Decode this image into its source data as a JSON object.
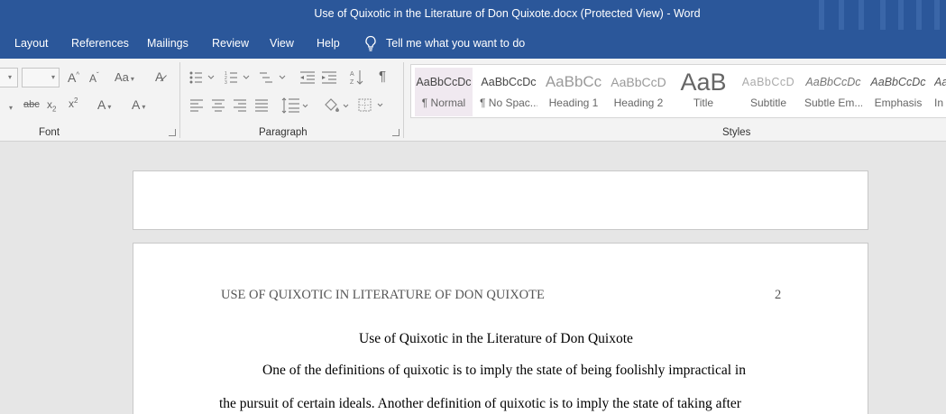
{
  "window": {
    "title": "Use of Quixotic in the Literature of Don Quixote.docx (Protected View)  -  Word"
  },
  "menu": {
    "items": [
      "Layout",
      "References",
      "Mailings",
      "Review",
      "View",
      "Help"
    ],
    "tell_me": "Tell me what you want to do"
  },
  "ribbon": {
    "groups": {
      "font": "Font",
      "paragraph": "Paragraph",
      "styles": "Styles"
    },
    "change_case_label": "Aa",
    "font_color_label": "A",
    "highlight_label": "A",
    "styles": [
      {
        "preview": "AaBbCcDc",
        "name": "¶ Normal",
        "selected": true
      },
      {
        "preview": "AaBbCcDc",
        "name": "¶ No Spac..."
      },
      {
        "preview": "AaBbCc",
        "name": "Heading 1"
      },
      {
        "preview": "AaBbCcD",
        "name": "Heading 2"
      },
      {
        "preview": "AaB",
        "name": "Title"
      },
      {
        "preview": "AaBbCcD",
        "name": "Subtitle"
      },
      {
        "preview": "AaBbCcDc",
        "name": "Subtle Em..."
      },
      {
        "preview": "AaBbCcDc",
        "name": "Emphasis"
      },
      {
        "preview": "AaBbCcDc",
        "name": "In"
      }
    ]
  },
  "document": {
    "header_text": "USE OF QUIXOTIC IN LITERATURE OF DON QUIXOTE",
    "page_number": "2",
    "title": "Use of Quixotic in the Literature of Don Quixote",
    "para_line1": "One of the definitions of quixotic is to imply the state of being foolishly impractical in",
    "para_line2": "the pursuit of certain ideals. Another definition of quixotic is to imply the state of taking after"
  },
  "colors": {
    "word_blue": "#2b579a",
    "ribbon_bg": "#f3f3f3",
    "canvas": "#e6e6e6"
  }
}
